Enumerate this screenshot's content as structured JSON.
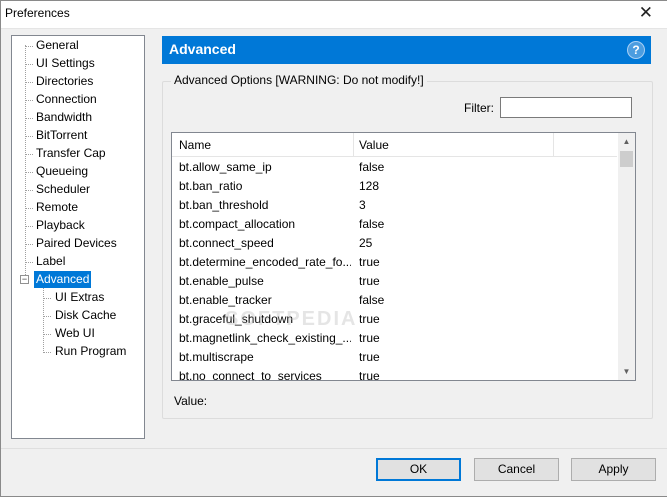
{
  "window": {
    "title": "Preferences",
    "close_glyph": "✕"
  },
  "tree": {
    "items": [
      {
        "label": "General"
      },
      {
        "label": "UI Settings"
      },
      {
        "label": "Directories"
      },
      {
        "label": "Connection"
      },
      {
        "label": "Bandwidth"
      },
      {
        "label": "BitTorrent"
      },
      {
        "label": "Transfer Cap"
      },
      {
        "label": "Queueing"
      },
      {
        "label": "Scheduler"
      },
      {
        "label": "Remote"
      },
      {
        "label": "Playback"
      },
      {
        "label": "Paired Devices"
      },
      {
        "label": "Label"
      },
      {
        "label": "Advanced",
        "selected": true
      },
      {
        "label": "UI Extras"
      },
      {
        "label": "Disk Cache"
      },
      {
        "label": "Web UI"
      },
      {
        "label": "Run Program"
      }
    ],
    "expander_glyph": "−"
  },
  "panel": {
    "title": "Advanced",
    "help_glyph": "?",
    "group_label": "Advanced Options [WARNING: Do not modify!]",
    "filter_label": "Filter:",
    "filter_value": "",
    "columns": {
      "name": "Name",
      "value": "Value"
    },
    "rows": [
      {
        "name": "bt.allow_same_ip",
        "value": "false"
      },
      {
        "name": "bt.ban_ratio",
        "value": "128"
      },
      {
        "name": "bt.ban_threshold",
        "value": "3"
      },
      {
        "name": "bt.compact_allocation",
        "value": "false"
      },
      {
        "name": "bt.connect_speed",
        "value": "25"
      },
      {
        "name": "bt.determine_encoded_rate_fo...",
        "value": "true"
      },
      {
        "name": "bt.enable_pulse",
        "value": "true"
      },
      {
        "name": "bt.enable_tracker",
        "value": "false"
      },
      {
        "name": "bt.graceful_shutdown",
        "value": "true"
      },
      {
        "name": "bt.magnetlink_check_existing_...",
        "value": "true"
      },
      {
        "name": "bt.multiscrape",
        "value": "true"
      },
      {
        "name": "bt.no_connect_to_services",
        "value": "true"
      }
    ],
    "value_label": "Value:"
  },
  "scrollbar": {
    "up_glyph": "▲",
    "down_glyph": "▼"
  },
  "buttons": {
    "ok": "OK",
    "cancel": "Cancel",
    "apply": "Apply"
  },
  "watermark": "SOFTPEDIA",
  "colors": {
    "accent": "#0078d7",
    "selection": "#0078d7"
  }
}
